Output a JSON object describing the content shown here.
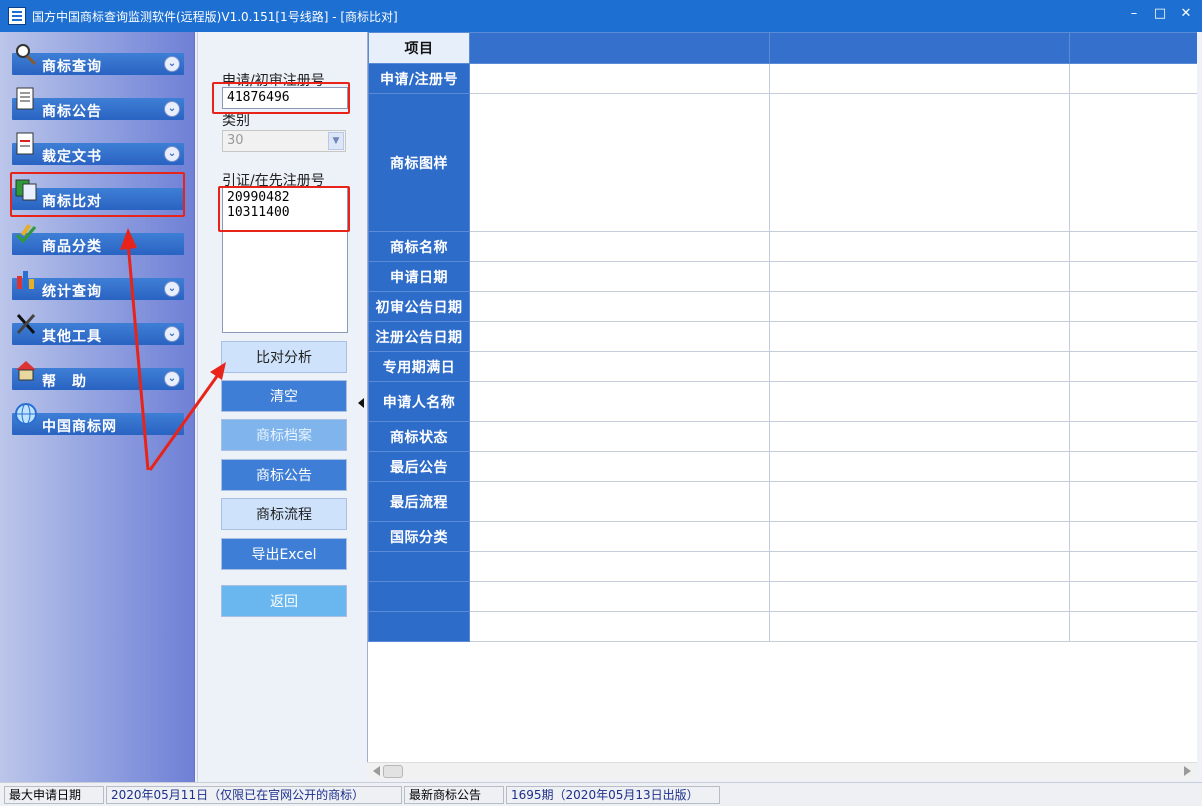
{
  "window": {
    "title": "国方中国商标查询监测软件(远程版)V1.0.151[1号线路] - [商标比对]",
    "minimize": "–",
    "maximize": "□",
    "close": "✕"
  },
  "sidebar": {
    "items": [
      {
        "label": "商标查询",
        "icon": "magnifier-icon"
      },
      {
        "label": "商标公告",
        "icon": "notice-icon"
      },
      {
        "label": "裁定文书",
        "icon": "document-icon"
      },
      {
        "label": "商标比对",
        "icon": "compare-icon"
      },
      {
        "label": "商品分类",
        "icon": "pencil-check-icon"
      },
      {
        "label": "统计查询",
        "icon": "bar-chart-icon"
      },
      {
        "label": "其他工具",
        "icon": "tools-icon"
      },
      {
        "label": "帮　助",
        "icon": "help-icon"
      },
      {
        "label": "中国商标网",
        "icon": "globe-icon"
      }
    ],
    "chevron": "⌄"
  },
  "form": {
    "reg_no_label": "申请/初审注册号",
    "reg_no_value": "41876496",
    "class_label": "类别",
    "class_value": "30",
    "cited_label": "引证/在先注册号",
    "cited_values": [
      "20990482",
      "10311400"
    ]
  },
  "buttons": {
    "compare": "比对分析",
    "clear": "清空",
    "archive": "商标档案",
    "announcement": "商标公告",
    "flow": "商标流程",
    "export": "导出Excel",
    "back": "返回"
  },
  "grid": {
    "header": "项目",
    "rows": [
      "申请/注册号",
      "商标图样",
      "商标名称",
      "申请日期",
      "初审公告日期",
      "注册公告日期",
      "专用期满日",
      "申请人名称",
      "商标状态",
      "最后公告",
      "最后流程",
      "国际分类",
      "",
      "",
      ""
    ]
  },
  "status": {
    "label1": "最大申请日期",
    "value1": "2020年05月11日（仅限已在官网公开的商标）",
    "label2": "最新商标公告",
    "value2": "1695期（2020年05月13日出版）"
  },
  "colors": {
    "highlight": "#e8241a",
    "accent": "#2e6cc9"
  }
}
